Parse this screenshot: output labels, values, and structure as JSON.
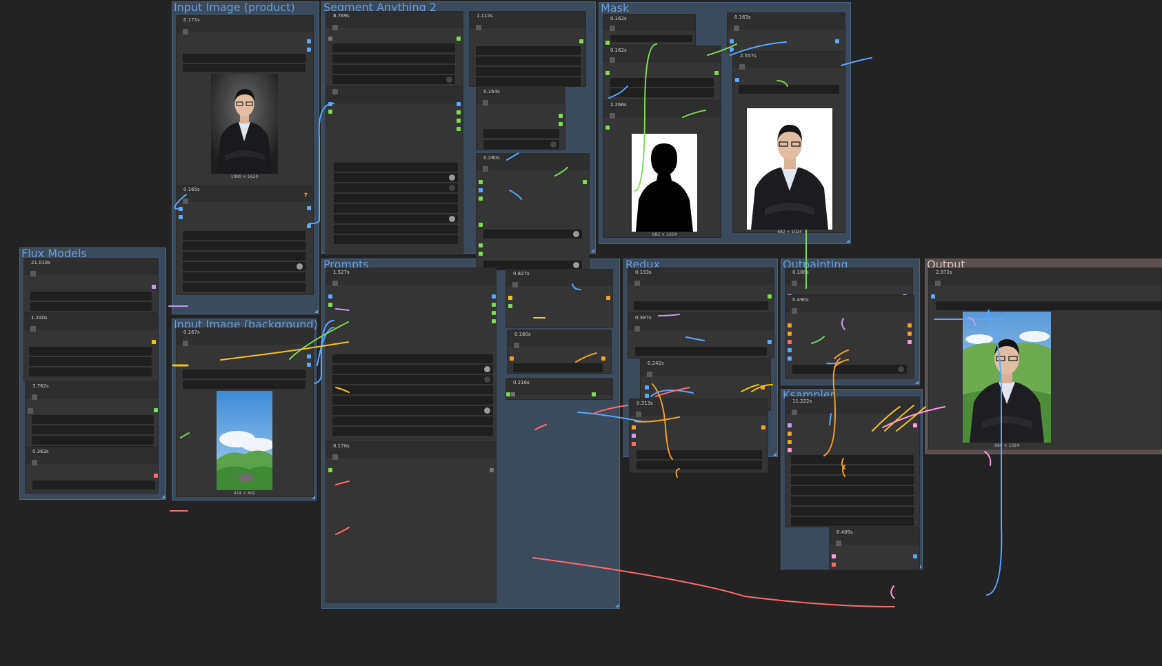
{
  "groups": {
    "input_product": "Input Image (product)",
    "segment": "Segment Anything 2",
    "mask": "Mask",
    "flux": "Flux Models",
    "input_background": "Input Image (background)",
    "prompts": "Prompts",
    "redux": "Redux",
    "outpainting": "Outpainting",
    "ksampler": "Ksampler",
    "output": "Output"
  },
  "timings": {
    "product_load": "0.171s",
    "product_resize": "0.165s",
    "sam_model": "8.769s",
    "sam_detect": "1.115s",
    "sam_a": "0.164s",
    "sam_b": "0.280s",
    "mask_a": "0.162s",
    "mask_b": "0.162s",
    "mask_c": "2.266s",
    "mask_d": "0.163s",
    "mask_e": "2.557s",
    "flux_unet": "21.018s",
    "flux_clip": "1.240s",
    "flux_vae": "3.762s",
    "flux_style": "0.363s",
    "bg_load": "0.167s",
    "prompts_main": "1.527s",
    "prompts_neg": "0.170s",
    "prompts_a": "0.827s",
    "prompts_b": "0.160s",
    "prompts_c": "0.216s",
    "redux_a": "0.193s",
    "redux_b": "0.387s",
    "redux_c": "0.242s",
    "redux_d": "0.313s",
    "out_a": "0.188s",
    "out_b": "0.490s",
    "ksampler_main": "11.222s",
    "ksampler_decode": "0.409s",
    "output_save": "2.972s"
  },
  "captions": {
    "product_size": "1080 × 1620",
    "mask_size": "682 × 1024",
    "mask_preview_size": "682 × 1024",
    "bg_size": "474 × 842",
    "output_size": "680 × 1024"
  },
  "warning_glyph": "?",
  "colors": {
    "canvas": "#232323",
    "group": "#3b4b5c",
    "group_title": "#6f9cd4",
    "node": "#353535",
    "image": "#5aa7ff",
    "mask": "#7ed957",
    "clip": "#f5c518",
    "conditioning": "#f0a030",
    "model": "#c89cf0",
    "vae": "#ff6b6b",
    "latent": "#ff9ae0"
  }
}
